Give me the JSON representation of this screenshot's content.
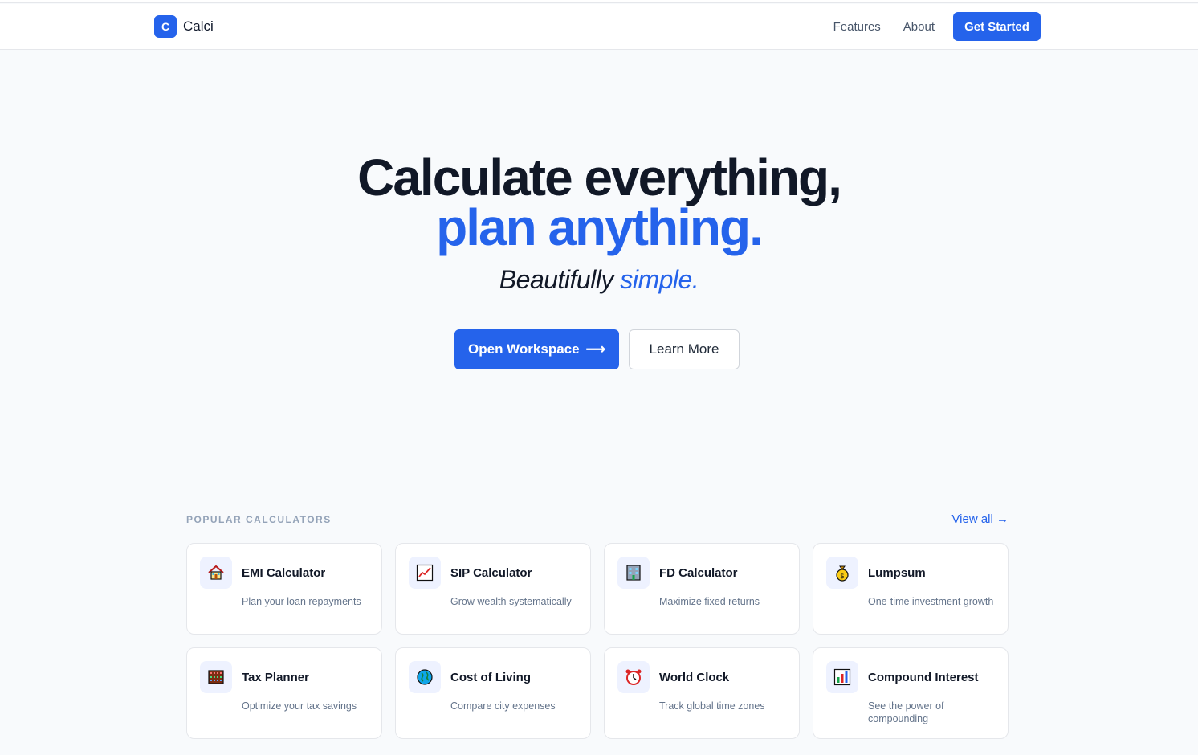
{
  "header": {
    "logo_letter": "C",
    "brand": "Calci",
    "nav": [
      "Features",
      "About"
    ],
    "cta": "Get Started"
  },
  "hero": {
    "line1": "Calculate everything,",
    "line2": "plan anything.",
    "sub_plain": "Beautifully",
    "sub_accent": "simple.",
    "primary_cta": "Open Workspace",
    "primary_arrow": "⟶",
    "secondary_cta": "Learn More"
  },
  "section": {
    "title": "POPULAR CALCULATORS",
    "view_all": "View all →"
  },
  "cards": [
    {
      "title": "EMI Calculator",
      "desc": "Plan your loan repayments",
      "icon": "house-icon"
    },
    {
      "title": "SIP Calculator",
      "desc": "Grow wealth systematically",
      "icon": "chart-up-icon"
    },
    {
      "title": "FD Calculator",
      "desc": "Maximize fixed returns",
      "icon": "bank-building-icon"
    },
    {
      "title": "Lumpsum",
      "desc": "One-time investment growth",
      "icon": "money-bag-icon"
    },
    {
      "title": "Tax Planner",
      "desc": "Optimize your tax savings",
      "icon": "abacus-icon"
    },
    {
      "title": "Cost of Living",
      "desc": "Compare city expenses",
      "icon": "globe-icon"
    },
    {
      "title": "World Clock",
      "desc": "Track global time zones",
      "icon": "alarm-clock-icon"
    },
    {
      "title": "Compound Interest",
      "desc": "See the power of compounding",
      "icon": "bar-chart-icon"
    }
  ],
  "colors": {
    "accent": "#2563eb",
    "background": "#f8fafc",
    "heading": "#111827"
  }
}
